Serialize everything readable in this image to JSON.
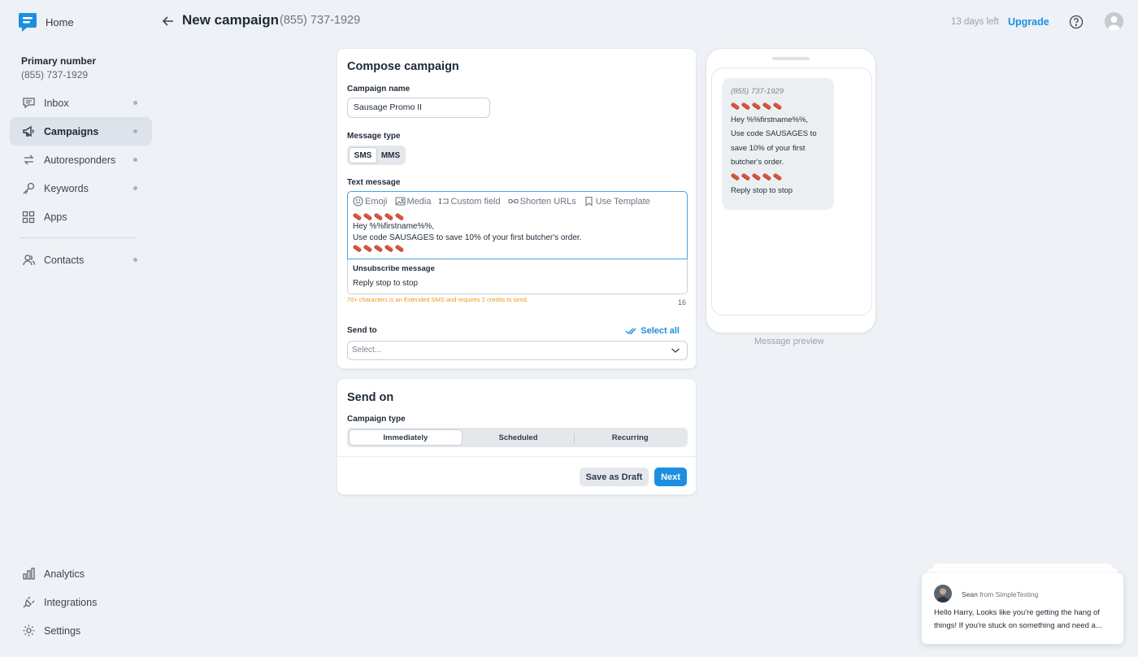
{
  "sidebar": {
    "home_label": "Home",
    "primary_title": "Primary number",
    "primary_number": "(855) 737-1929",
    "items": [
      {
        "label": "Inbox",
        "icon": "inbox-icon"
      },
      {
        "label": "Campaigns",
        "icon": "megaphone-icon",
        "active": true
      },
      {
        "label": "Autoresponders",
        "icon": "autoresponder-icon"
      },
      {
        "label": "Keywords",
        "icon": "key-icon"
      },
      {
        "label": "Apps",
        "icon": "apps-grid-icon"
      },
      {
        "label": "Contacts",
        "icon": "contacts-icon"
      }
    ],
    "bottom_items": [
      {
        "label": "Analytics",
        "icon": "bar-chart-icon"
      },
      {
        "label": "Integrations",
        "icon": "plug-icon"
      },
      {
        "label": "Settings",
        "icon": "gear-icon"
      }
    ]
  },
  "header": {
    "title": "New campaign",
    "subtitle": "(855) 737-1929",
    "trial": "13 days left",
    "upgrade": "Upgrade"
  },
  "compose": {
    "title": "Compose campaign",
    "name_label": "Campaign name",
    "name_value": "Sausage Promo II",
    "type_label": "Message type",
    "type_options": [
      "SMS",
      "MMS"
    ],
    "type_selected": "SMS",
    "text_label": "Text message",
    "toolbar": [
      "Emoji",
      "Media",
      "Custom field",
      "Shorten URLs",
      "Use Template"
    ],
    "message_line1": "Hey %%firstname%%,",
    "message_line2": "Use code SAUSAGES to save 10% of your first butcher's order.",
    "unsub_title": "Unsubscribe message",
    "unsub_text": "Reply stop to stop",
    "warning": "70+ characters is an Extended SMS and requires 2 credits to send.",
    "char_count": "16",
    "sendto_label": "Send to",
    "select_all": "Select all",
    "select_placeholder": "Select..."
  },
  "sendon": {
    "title": "Send on",
    "type_label": "Campaign type",
    "options": [
      "Immediately",
      "Scheduled",
      "Recurring"
    ],
    "selected": "Immediately",
    "draft_label": "Save as Draft",
    "next_label": "Next"
  },
  "preview": {
    "from": "(855) 737-1929",
    "line1": "Hey %%firstname%%,",
    "line2": "Use code SAUSAGES to",
    "line3": "save 10% of your first",
    "line4": "butcher's order.",
    "line5": "Reply stop to stop",
    "label": "Message preview"
  },
  "chat": {
    "sender": "Sean",
    "from_text": "from SimpleTexting",
    "message": "Hello Harry, Looks like you're getting the hang of things! If you're stuck on something and need a..."
  },
  "colors": {
    "accent": "#1d8fe0",
    "warning": "#e89a1a",
    "background": "#eef1f5"
  }
}
